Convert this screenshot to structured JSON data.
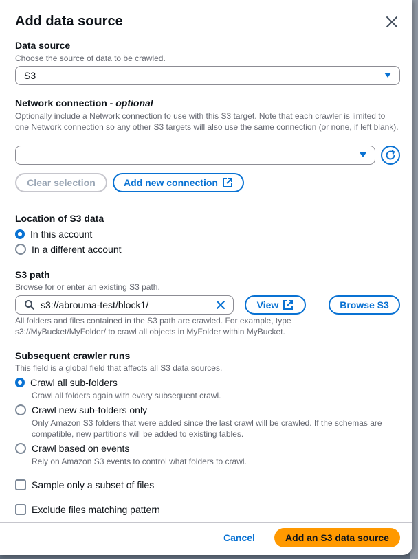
{
  "modal": {
    "title": "Add data source"
  },
  "data_source": {
    "label": "Data source",
    "description": "Choose the source of data to be crawled.",
    "value": "S3"
  },
  "network_connection": {
    "label": "Network connection - ",
    "label_optional": "optional",
    "description": "Optionally include a Network connection to use with this S3 target. Note that each crawler is limited to one Network connection so any other S3 targets will also use the same connection (or none, if left blank).",
    "value": "",
    "clear_label": "Clear selection",
    "add_label": "Add new connection"
  },
  "location": {
    "label": "Location of S3 data",
    "options": [
      "In this account",
      "In a different account"
    ],
    "selected": 0
  },
  "s3_path": {
    "label": "S3 path",
    "description": "Browse for or enter an existing S3 path.",
    "value": "s3://abrouma-test/block1/",
    "view_label": "View",
    "browse_label": "Browse S3",
    "help": "All folders and files contained in the S3 path are crawled. For example, type s3://MyBucket/MyFolder/ to crawl all objects in MyFolder within MyBucket."
  },
  "crawler_runs": {
    "label": "Subsequent crawler runs",
    "description": "This field is a global field that affects all S3 data sources.",
    "options": [
      {
        "label": "Crawl all sub-folders",
        "desc": "Crawl all folders again with every subsequent crawl."
      },
      {
        "label": "Crawl new sub-folders only",
        "desc": "Only Amazon S3 folders that were added since the last crawl will be crawled. If the schemas are compatible, new partitions will be added to existing tables."
      },
      {
        "label": "Crawl based on events",
        "desc": "Rely on Amazon S3 events to control what folders to crawl."
      }
    ],
    "selected": 0
  },
  "checkboxes": {
    "sample": "Sample only a subset of files",
    "exclude": "Exclude files matching pattern"
  },
  "footer": {
    "cancel": "Cancel",
    "submit": "Add an S3 data source"
  }
}
